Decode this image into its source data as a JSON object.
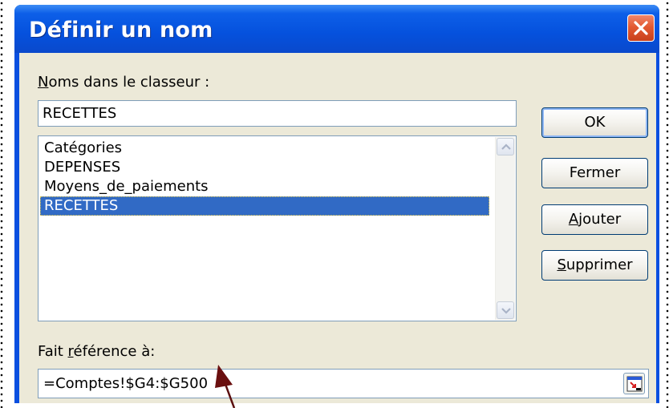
{
  "window": {
    "title": "Définir un nom"
  },
  "names_label_u": "N",
  "names_label_rest": "oms dans le classeur :",
  "names_input_value": "RECETTES",
  "names_list": [
    {
      "label": "Catégories",
      "selected": false
    },
    {
      "label": "DEPENSES",
      "selected": false
    },
    {
      "label": "Moyens_de_paiements",
      "selected": false
    },
    {
      "label": "RECETTES",
      "selected": true
    }
  ],
  "ref_label_pre": "Fait ",
  "ref_label_u": "r",
  "ref_label_rest": "éférence à:",
  "ref_input_value": "=Comptes!$G4:$G500",
  "buttons": {
    "ok": "OK",
    "close": "Fermer",
    "add_u": "A",
    "add_rest": "jouter",
    "delete_u": "S",
    "delete_rest": "upprimer"
  },
  "icons": {
    "close": "close-x-icon",
    "scroll_up": "chevron-up-icon",
    "scroll_down": "chevron-down-icon",
    "collapse": "collapse-dialog-icon",
    "annotation": "annotation-arrow"
  },
  "colors": {
    "titlebar": "#0551dd",
    "selection": "#316ac5",
    "client": "#ece9d8",
    "close": "#e35a32",
    "annotation_arrow": "#5b0f0f"
  }
}
